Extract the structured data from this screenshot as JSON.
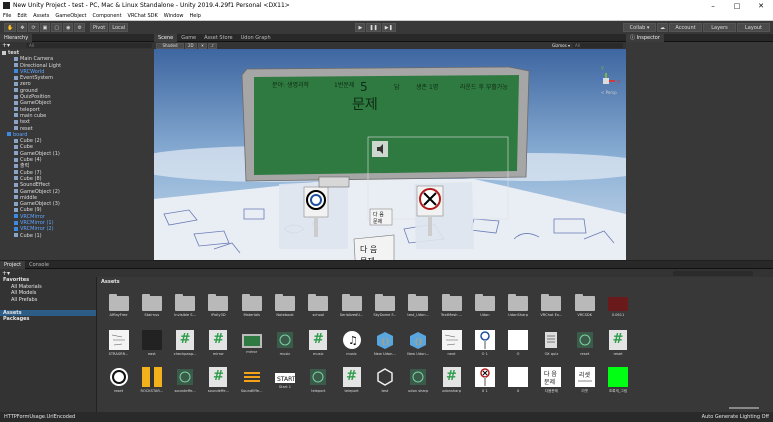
{
  "window": {
    "title": "New Unity Project - test - PC, Mac & Linux Standalone - Unity 2019.4.29f1 Personal <DX11>"
  },
  "menu": [
    "File",
    "Edit",
    "Assets",
    "GameObject",
    "Component",
    "VRChat SDK",
    "Window",
    "Help"
  ],
  "toolbar": {
    "pivot": "Pivot",
    "local": "Local",
    "collab": "Collab ▾",
    "account": "Account",
    "layers": "Layers",
    "layout": "Layout"
  },
  "hierarchy": {
    "tab": "Hierarchy",
    "search_placeholder": "All",
    "scene": "test",
    "items": [
      {
        "name": "Main Camera",
        "ind": 2,
        "blue": false
      },
      {
        "name": "Directional Light",
        "ind": 2,
        "blue": false
      },
      {
        "name": "VRCWorld",
        "ind": 2,
        "blue": true
      },
      {
        "name": "EventSystem",
        "ind": 2,
        "blue": false
      },
      {
        "name": "zero",
        "ind": 2,
        "blue": false
      },
      {
        "name": "ground",
        "ind": 2,
        "blue": false
      },
      {
        "name": "QuizPosition",
        "ind": 2,
        "blue": false
      },
      {
        "name": "GameObject",
        "ind": 2,
        "blue": false
      },
      {
        "name": "teleport",
        "ind": 2,
        "blue": false
      },
      {
        "name": "main cube",
        "ind": 2,
        "blue": false
      },
      {
        "name": "text",
        "ind": 2,
        "blue": false
      },
      {
        "name": "reset",
        "ind": 2,
        "blue": false
      },
      {
        "name": "board",
        "ind": 1,
        "blue": true
      },
      {
        "name": "Cube (2)",
        "ind": 2,
        "blue": false
      },
      {
        "name": "Cube",
        "ind": 2,
        "blue": false
      },
      {
        "name": "GameObject (1)",
        "ind": 2,
        "blue": false
      },
      {
        "name": "Cube (4)",
        "ind": 2,
        "blue": false
      },
      {
        "name": "출력",
        "ind": 2,
        "blue": false
      },
      {
        "name": "Cube (7)",
        "ind": 2,
        "blue": false
      },
      {
        "name": "Cube (8)",
        "ind": 2,
        "blue": false
      },
      {
        "name": "SoundEffect",
        "ind": 2,
        "blue": false
      },
      {
        "name": "GameObject (2)",
        "ind": 2,
        "blue": false
      },
      {
        "name": "middle",
        "ind": 2,
        "blue": false
      },
      {
        "name": "GameObject (3)",
        "ind": 2,
        "blue": false
      },
      {
        "name": "Cube (9)",
        "ind": 2,
        "blue": false
      },
      {
        "name": "VRCMirror",
        "ind": 2,
        "blue": true
      },
      {
        "name": "VRCMirror (1)",
        "ind": 2,
        "blue": true
      },
      {
        "name": "VRCMirror (2)",
        "ind": 2,
        "blue": true
      },
      {
        "name": "Cube (1)",
        "ind": 2,
        "blue": false
      }
    ]
  },
  "scene": {
    "tabs": [
      "Scene",
      "Game",
      "Asset Store",
      "Udon Graph"
    ],
    "shading": "Shaded",
    "mode2d": "2D",
    "gizmos": "Gizmos ▾",
    "search_placeholder": "All",
    "board": {
      "cells": [
        "분야: 생명과학",
        "1번문제",
        "5",
        "문제",
        "답",
        "생존 1명",
        "라운드 후 부활가능"
      ]
    },
    "buttons": {
      "next": "다음\n문제",
      "next_small": "다음\n문제"
    }
  },
  "inspector": {
    "tab": "Inspector"
  },
  "project": {
    "tabs": [
      "Project",
      "Console"
    ],
    "search_placeholder": "",
    "tree": [
      {
        "label": "Favorites",
        "ind": 0,
        "bold": true
      },
      {
        "label": "All Materials",
        "ind": 1,
        "bold": false
      },
      {
        "label": "All Models",
        "ind": 1,
        "bold": false
      },
      {
        "label": "All Prefabs",
        "ind": 1,
        "bold": false
      },
      {
        "label": "",
        "ind": 0,
        "bold": false
      },
      {
        "label": "Assets",
        "ind": 0,
        "bold": true
      },
      {
        "label": "Packages",
        "ind": 0,
        "bold": true
      }
    ],
    "breadcrumb": "Assets",
    "assets": [
      {
        "label": "AfflayFree",
        "kind": "folder"
      },
      {
        "label": "Stairnus",
        "kind": "folder"
      },
      {
        "label": "Invisible S...",
        "kind": "folder"
      },
      {
        "label": "iPolly3D",
        "kind": "folder"
      },
      {
        "label": "Materials",
        "kind": "folder"
      },
      {
        "label": "Notebook",
        "kind": "folder"
      },
      {
        "label": "school",
        "kind": "folder"
      },
      {
        "label": "SerializedU...",
        "kind": "folder"
      },
      {
        "label": "SkyDome F...",
        "kind": "folder"
      },
      {
        "label": "test_Udon...",
        "kind": "folder"
      },
      {
        "label": "TextMesh ...",
        "kind": "folder"
      },
      {
        "label": "Udon",
        "kind": "folder"
      },
      {
        "label": "UdonSharp",
        "kind": "folder"
      },
      {
        "label": "VRChat Ex...",
        "kind": "folder"
      },
      {
        "label": "VRCSDK",
        "kind": "folder"
      },
      {
        "label": "0.0611",
        "kind": "red"
      },
      {
        "label": "STRASRR...",
        "kind": "sketch"
      },
      {
        "label": "east",
        "kind": "dark"
      },
      {
        "label": "checkpaop...",
        "kind": "cs"
      },
      {
        "label": "mirror",
        "kind": "cs"
      },
      {
        "label": "mirror",
        "kind": "board"
      },
      {
        "label": "music",
        "kind": "udon"
      },
      {
        "label": "music",
        "kind": "cs"
      },
      {
        "label": "music",
        "kind": "note"
      },
      {
        "label": "New Udon...",
        "kind": "cube"
      },
      {
        "label": "New Udon...",
        "kind": "cube"
      },
      {
        "label": "next",
        "kind": "sketch"
      },
      {
        "label": "O 1",
        "kind": "circle"
      },
      {
        "label": "O",
        "kind": "white"
      },
      {
        "label": "OX quiz",
        "kind": "doc"
      },
      {
        "label": "reset",
        "kind": "udon"
      },
      {
        "label": "reset",
        "kind": "cs"
      },
      {
        "label": "reset",
        "kind": "reset"
      },
      {
        "label": "ROCKSTAR...",
        "kind": "yellow"
      },
      {
        "label": "soundeffe...",
        "kind": "udon"
      },
      {
        "label": "soundeffe...",
        "kind": "cs"
      },
      {
        "label": "SoundEffe...",
        "kind": "audio"
      },
      {
        "label": "Start 1",
        "kind": "start"
      },
      {
        "label": "teleport",
        "kind": "udon"
      },
      {
        "label": "teleport",
        "kind": "cs"
      },
      {
        "label": "test",
        "kind": "unity"
      },
      {
        "label": "udon sharp",
        "kind": "udon"
      },
      {
        "label": "udonsharp",
        "kind": "cs"
      },
      {
        "label": "X 1",
        "kind": "xmark"
      },
      {
        "label": "X",
        "kind": "white"
      },
      {
        "label": "다음문제",
        "kind": "nextq"
      },
      {
        "label": "리셋",
        "kind": "reset2"
      },
      {
        "label": "초록색_그림",
        "kind": "green"
      }
    ]
  },
  "status": {
    "left": "HTTPFormUsage.UrlEncoded",
    "right": "Auto Generate Lighting Off"
  },
  "colors": {
    "board": "#2f7a40",
    "sky": "#5f88b8",
    "green": "#00ff12"
  }
}
